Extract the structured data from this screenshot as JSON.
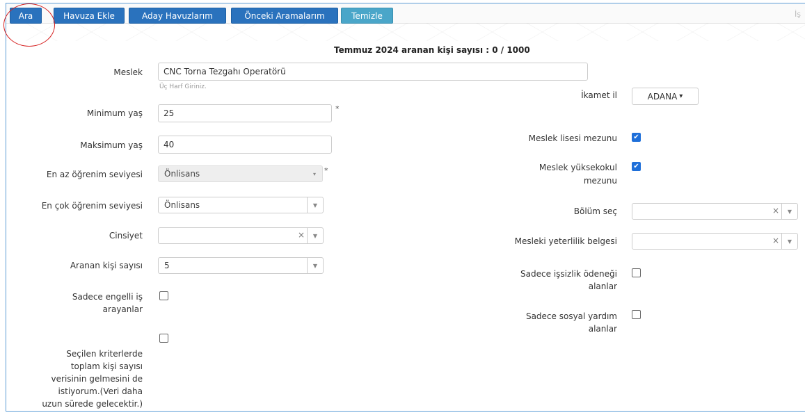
{
  "toolbar": {
    "ara": "Ara",
    "havuza_ekle": "Havuza Ekle",
    "aday_havuzlarim": "Aday Havuzlarım",
    "onceki_aramalarim": "Önceki Aramalarım",
    "temizle": "Temizle",
    "trailing_text": "İş"
  },
  "summary": "Temmuz 2024 aranan kişi sayısı : 0 / 1000",
  "left": {
    "meslek": {
      "label": "Meslek",
      "value": "CNC Torna Tezgahı Operatörü",
      "hint": "Üç Harf Giriniz."
    },
    "min_yas": {
      "label": "Minimum yaş",
      "value": "25",
      "required": "*"
    },
    "max_yas": {
      "label": "Maksimum yaş",
      "value": "40"
    },
    "en_az": {
      "label": "En az öğrenim seviyesi",
      "value": "Önlisans",
      "required": "*"
    },
    "en_cok": {
      "label": "En çok öğrenim seviyesi",
      "value": "Önlisans"
    },
    "cinsiyet": {
      "label": "Cinsiyet",
      "value": ""
    },
    "aranan": {
      "label": "Aranan kişi sayısı",
      "value": "5"
    },
    "engelli": {
      "label_line1": "Sadece engelli iş",
      "label_line2": "arayanlar",
      "checked": false
    },
    "toplam": {
      "lines": [
        "Seçilen kriterlerde",
        "toplam kişi sayısı",
        "verisinin gelmesini de",
        "istiyorum.(Veri daha",
        "uzun sürede gelecektir.)"
      ],
      "checked": false
    }
  },
  "right": {
    "ikamet": {
      "label": "İkamet il",
      "value": "ADANA"
    },
    "lise": {
      "label": "Meslek lisesi mezunu",
      "checked": true
    },
    "yuksekokul": {
      "label_line1": "Meslek yüksekokul",
      "label_line2": "mezunu",
      "checked": true
    },
    "bolum": {
      "label": "Bölüm seç",
      "value": ""
    },
    "yeterlilik": {
      "label": "Mesleki yeterlilik belgesi",
      "value": ""
    },
    "issizlik": {
      "label_line1": "Sadece işsizlik ödeneği",
      "label_line2": "alanlar",
      "checked": false
    },
    "sosyal": {
      "label_line1": "Sadece sosyal yardım",
      "label_line2": "alanlar",
      "checked": false
    }
  },
  "icons": {
    "clear": "×",
    "arrow": "▼",
    "caret": "▾",
    "check": "✔"
  },
  "colors": {
    "primary_button": "#2a72bd",
    "info_button": "#4aa6c9",
    "checkbox_checked": "#1e6fd9",
    "highlight_circle": "#d62020"
  }
}
